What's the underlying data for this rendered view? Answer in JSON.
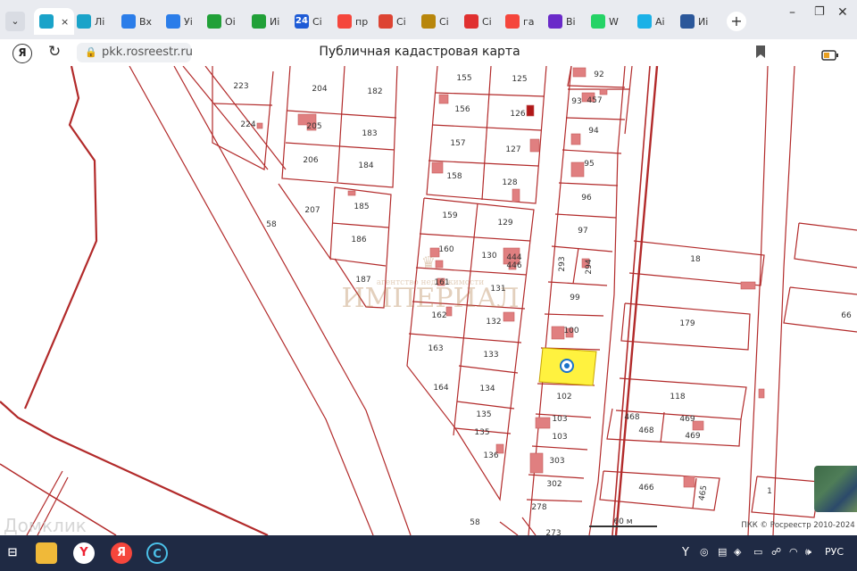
{
  "browser": {
    "tabs": [
      {
        "label": "",
        "icon": "rosreestr-icon",
        "color": "#1aa3c9",
        "active": true
      },
      {
        "label": "Лі",
        "icon": "rosreestr-icon",
        "color": "#1aa3c9"
      },
      {
        "label": "Вх",
        "icon": "mail-icon",
        "color": "#2b7de9"
      },
      {
        "label": "Уі",
        "icon": "b-icon",
        "color": "#2b7de9"
      },
      {
        "label": "Оі",
        "icon": "domclick-icon",
        "color": "#21a038"
      },
      {
        "label": "Иі",
        "icon": "domclick-icon",
        "color": "#21a038"
      },
      {
        "label": "Сі",
        "icon": "24-icon",
        "color": "#1e5bd6",
        "text": "24"
      },
      {
        "label": "пр",
        "icon": "yandex-icon",
        "color": "#f5463c"
      },
      {
        "label": "Сі",
        "icon": "flag-icon",
        "color": "#d43"
      },
      {
        "label": "Сі",
        "icon": "emblem-icon",
        "color": "#b8860b"
      },
      {
        "label": "Сі",
        "icon": "list-icon",
        "color": "#e03030"
      },
      {
        "label": "га",
        "icon": "yandex-icon",
        "color": "#f5463c"
      },
      {
        "label": "Ві",
        "icon": "brand-icon",
        "color": "#6a2ac9"
      },
      {
        "label": "W",
        "icon": "whatsapp-icon",
        "color": "#25d366"
      },
      {
        "label": "Аі",
        "icon": "cube-icon",
        "color": "#1bb1e7"
      },
      {
        "label": "Иі",
        "icon": "word-icon",
        "color": "#2b579a"
      }
    ],
    "url": "pkk.rosreestr.ru",
    "page_title": "Публичная кадастровая карта"
  },
  "map": {
    "parcels": [
      {
        "label": "223"
      },
      {
        "label": "224"
      },
      {
        "label": "204"
      },
      {
        "label": "182"
      },
      {
        "label": "205"
      },
      {
        "label": "183"
      },
      {
        "label": "206"
      },
      {
        "label": "184"
      },
      {
        "label": "207"
      },
      {
        "label": "185"
      },
      {
        "label": "186"
      },
      {
        "label": "187"
      },
      {
        "label": "58"
      },
      {
        "label": "155"
      },
      {
        "label": "125"
      },
      {
        "label": "156"
      },
      {
        "label": "126"
      },
      {
        "label": "157"
      },
      {
        "label": "127"
      },
      {
        "label": "158"
      },
      {
        "label": "128"
      },
      {
        "label": "159"
      },
      {
        "label": "129"
      },
      {
        "label": "160"
      },
      {
        "label": "130"
      },
      {
        "label": "444"
      },
      {
        "label": "446"
      },
      {
        "label": "161"
      },
      {
        "label": "131"
      },
      {
        "label": "162"
      },
      {
        "label": "132"
      },
      {
        "label": "163"
      },
      {
        "label": "133"
      },
      {
        "label": "164"
      },
      {
        "label": "134"
      },
      {
        "label": "135"
      },
      {
        "label": "135"
      },
      {
        "label": "136"
      },
      {
        "label": "92"
      },
      {
        "label": "93"
      },
      {
        "label": "457"
      },
      {
        "label": "94"
      },
      {
        "label": "95"
      },
      {
        "label": "96"
      },
      {
        "label": "97"
      },
      {
        "label": "293"
      },
      {
        "label": "294"
      },
      {
        "label": "99"
      },
      {
        "label": "100"
      },
      {
        "label": "102"
      },
      {
        "label": "103"
      },
      {
        "label": "103"
      },
      {
        "label": "303"
      },
      {
        "label": "302"
      },
      {
        "label": "278"
      },
      {
        "label": "58"
      },
      {
        "label": "273"
      },
      {
        "label": "18"
      },
      {
        "label": "179"
      },
      {
        "label": "118"
      },
      {
        "label": "468"
      },
      {
        "label": "468"
      },
      {
        "label": "469"
      },
      {
        "label": "469"
      },
      {
        "label": "466"
      },
      {
        "label": "465"
      },
      {
        "label": "66"
      },
      {
        "label": "1"
      }
    ],
    "watermark_text": "ИМПЕРИАЛ",
    "watermark_sub": "агентство недвижимости",
    "scale_label": "60 м",
    "attribution": "ПКК © Росреестр 2010-2024",
    "corner_watermark": "Домклик",
    "colors": {
      "boundary": "#b22a2a",
      "building": "#e07f80",
      "selected": "#fff23f"
    }
  },
  "taskbar": {
    "language": "РУС",
    "items": [
      {
        "icon": "taskview-icon"
      },
      {
        "icon": "folder-icon"
      },
      {
        "icon": "yandex-browser-icon"
      },
      {
        "icon": "yandex-icon"
      },
      {
        "icon": "ccleaner-icon"
      }
    ]
  }
}
